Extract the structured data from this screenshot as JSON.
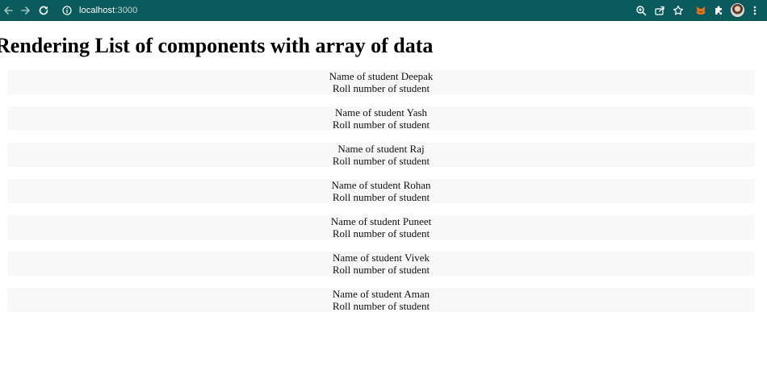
{
  "browser": {
    "url_host": "localhost",
    "url_port": ":3000",
    "colors": {
      "toolbar_bg": "#0b5a5c",
      "icon": "#ffffff"
    }
  },
  "page": {
    "title": "Rendering List of components with array of data",
    "students": [
      {
        "name_line": "Name of student Deepak",
        "roll_line": "Roll number of student"
      },
      {
        "name_line": "Name of student Yash",
        "roll_line": "Roll number of student"
      },
      {
        "name_line": "Name of student Raj",
        "roll_line": "Roll number of student"
      },
      {
        "name_line": "Name of student Rohan",
        "roll_line": "Roll number of student"
      },
      {
        "name_line": "Name of student Puneet",
        "roll_line": "Roll number of student"
      },
      {
        "name_line": "Name of student Vivek",
        "roll_line": "Roll number of student"
      },
      {
        "name_line": "Name of student Aman",
        "roll_line": "Roll number of student"
      }
    ],
    "colors": {
      "card_bg": "#f8f8f8",
      "text": "#111111"
    }
  }
}
